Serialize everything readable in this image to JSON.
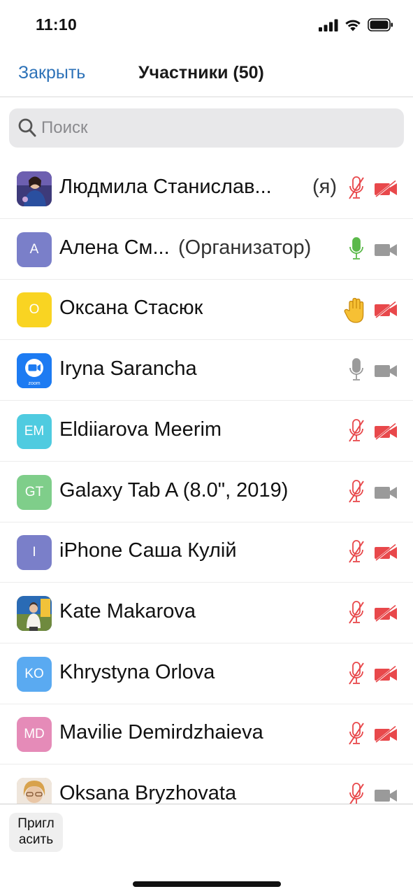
{
  "status_bar": {
    "time": "11:10"
  },
  "nav": {
    "close_label": "Закрыть",
    "title": "Участники (50)"
  },
  "search": {
    "placeholder": "Поиск",
    "value": ""
  },
  "participants": [
    {
      "name": "Людмила Станислав...",
      "suffix": "(я)",
      "avatar_letters": "",
      "avatar_color": "#5b4a8a",
      "avatar_kind": "photo",
      "mic": "muted",
      "camera": "off",
      "hand": false
    },
    {
      "name": "Алена См...",
      "suffix": "(Организатор)",
      "avatar_letters": "A",
      "avatar_color": "#7a7fc9",
      "avatar_kind": "letters",
      "mic": "active",
      "camera": "on",
      "hand": false
    },
    {
      "name": "Оксана Стасюк",
      "suffix": "",
      "avatar_letters": "O",
      "avatar_color": "#f9d422",
      "avatar_kind": "letters",
      "mic": "none",
      "camera": "off",
      "hand": true
    },
    {
      "name": "Iryna Sarancha",
      "suffix": "",
      "avatar_letters": "",
      "avatar_color": "#1d7bf2",
      "avatar_kind": "zoom",
      "mic": "on",
      "camera": "on",
      "hand": false
    },
    {
      "name": "Eldiiarova Meerim",
      "suffix": "",
      "avatar_letters": "EM",
      "avatar_color": "#4fcbe0",
      "avatar_kind": "letters",
      "mic": "muted",
      "camera": "off",
      "hand": false
    },
    {
      "name": "Galaxy Tab A (8.0\", 2019)",
      "suffix": "",
      "avatar_letters": "GT",
      "avatar_color": "#7fce8a",
      "avatar_kind": "letters",
      "mic": "muted",
      "camera": "on",
      "hand": false
    },
    {
      "name": "iPhone Саша Кулій",
      "suffix": "",
      "avatar_letters": "I",
      "avatar_color": "#7a7fc9",
      "avatar_kind": "letters",
      "mic": "muted",
      "camera": "off",
      "hand": false
    },
    {
      "name": "Kate Makarova",
      "suffix": "",
      "avatar_letters": "",
      "avatar_color": "#c8a24a",
      "avatar_kind": "photo",
      "mic": "muted",
      "camera": "off",
      "hand": false
    },
    {
      "name": "Khrystyna Orlova",
      "suffix": "",
      "avatar_letters": "KO",
      "avatar_color": "#5aaaf1",
      "avatar_kind": "letters",
      "mic": "muted",
      "camera": "off",
      "hand": false
    },
    {
      "name": "Mavilie Demirdzhaieva",
      "suffix": "",
      "avatar_letters": "MD",
      "avatar_color": "#e58bb8",
      "avatar_kind": "letters",
      "mic": "muted",
      "camera": "off",
      "hand": false
    },
    {
      "name": "Oksana Bryzhovata",
      "suffix": "",
      "avatar_letters": "",
      "avatar_color": "#d8b27a",
      "avatar_kind": "photo",
      "mic": "muted",
      "camera": "on",
      "hand": false
    }
  ],
  "bottom": {
    "invite_label": "Пригл\nасить"
  },
  "colors": {
    "accent": "#2d72b8",
    "muted_red": "#e8484b",
    "active_green": "#5bb94a",
    "icon_gray": "#9a9a9a"
  }
}
